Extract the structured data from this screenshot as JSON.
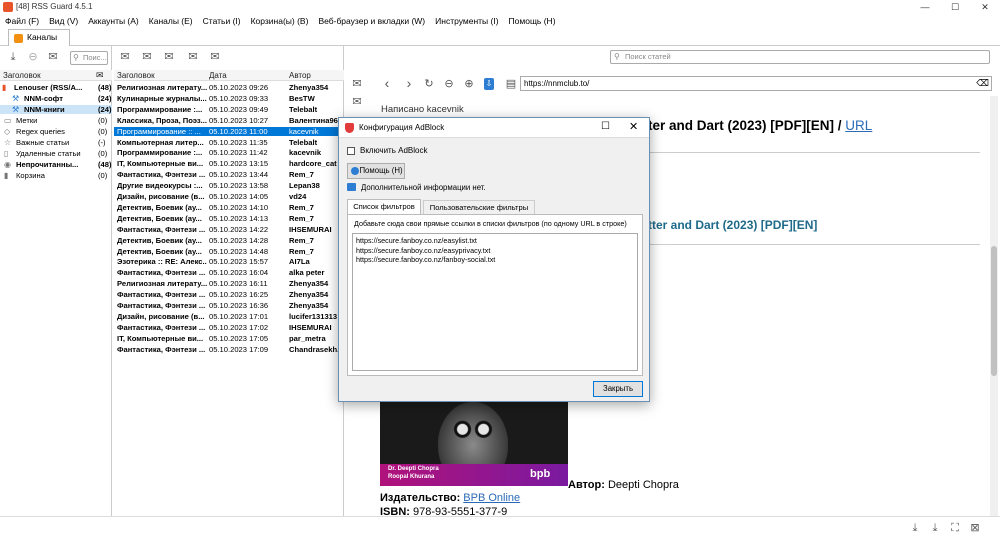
{
  "window": {
    "title": "[48] RSS Guard 4.5.1",
    "minimize": "—",
    "maximize": "☐",
    "close": "✕"
  },
  "menu": [
    "Файл (F)",
    "Вид (V)",
    "Аккаунты (A)",
    "Каналы (E)",
    "Статьи (I)",
    "Корзина(ы) (B)",
    "Веб-браузер и вкладки (W)",
    "Инструменты (I)",
    "Помощь (H)"
  ],
  "tab": {
    "label": "Каналы"
  },
  "feeds_search": {
    "placeholder": "Поис..."
  },
  "articles_search": {
    "placeholder": "Поиск статей"
  },
  "feeds_header": {
    "title": "Заголовок"
  },
  "feeds": [
    {
      "label": "Lenouser (RSS/A...",
      "count": "(48)",
      "bold": true,
      "sel": false
    },
    {
      "label": "NNM-софт",
      "count": "(24)",
      "bold": true,
      "sel": false
    },
    {
      "label": "NNM-книги",
      "count": "(24)",
      "bold": true,
      "sel": true
    },
    {
      "label": "Метки",
      "count": "(0)",
      "bold": false,
      "sel": false
    },
    {
      "label": "Regex queries",
      "count": "(0)",
      "bold": false,
      "sel": false
    },
    {
      "label": "Важные статьи",
      "count": "(-)",
      "bold": false,
      "sel": false
    },
    {
      "label": "Удаленные статьи",
      "count": "(0)",
      "bold": false,
      "sel": false
    },
    {
      "label": "Непрочитанны...",
      "count": "(48)",
      "bold": true,
      "sel": false
    },
    {
      "label": "Корзина",
      "count": "(0)",
      "bold": false,
      "sel": false
    }
  ],
  "articles_header": {
    "title": "Заголовок",
    "date": "Дата",
    "author": "Автор"
  },
  "articles": [
    {
      "title": "Религиозная литерату...",
      "date": "05.10.2023 09:26",
      "author": "Zhenya354"
    },
    {
      "title": "Кулинарные журналы...",
      "date": "05.10.2023 09:33",
      "author": "BesTW"
    },
    {
      "title": "Программирование :...",
      "date": "05.10.2023 09:49",
      "author": "Telebalt"
    },
    {
      "title": "Классика, Проза, Поэз...",
      "date": "05.10.2023 10:27",
      "author": "Валентина96"
    },
    {
      "title": "Программирование :: ...",
      "date": "05.10.2023 11:00",
      "author": "kacevnik"
    },
    {
      "title": "Компьютерная литер...",
      "date": "05.10.2023 11:35",
      "author": "Telebalt"
    },
    {
      "title": "Программирование :...",
      "date": "05.10.2023 11:42",
      "author": "kacevnik"
    },
    {
      "title": "IT, Компьютерные ви...",
      "date": "05.10.2023 13:15",
      "author": "hardcore_cat"
    },
    {
      "title": "Фантастика, Фэнтези ...",
      "date": "05.10.2023 13:44",
      "author": "Rem_7"
    },
    {
      "title": "Другие видеокурсы :...",
      "date": "05.10.2023 13:58",
      "author": "Lepan38"
    },
    {
      "title": "Дизайн, рисование (в...",
      "date": "05.10.2023 14:05",
      "author": "vd24"
    },
    {
      "title": "Детектив, Боевик (ау...",
      "date": "05.10.2023 14:10",
      "author": "Rem_7"
    },
    {
      "title": "Детектив, Боевик (ау...",
      "date": "05.10.2023 14:13",
      "author": "Rem_7"
    },
    {
      "title": "Фантастика, Фэнтези ...",
      "date": "05.10.2023 14:22",
      "author": "IHSEMURAI"
    },
    {
      "title": "Детектив, Боевик (ау...",
      "date": "05.10.2023 14:28",
      "author": "Rem_7"
    },
    {
      "title": "Детектив, Боевик (ау...",
      "date": "05.10.2023 14:48",
      "author": "Rem_7"
    },
    {
      "title": "Эзотерика :: RE: Алекс...",
      "date": "05.10.2023 15:57",
      "author": "AI7La"
    },
    {
      "title": "Фантастика, Фэнтези ...",
      "date": "05.10.2023 16:04",
      "author": "alka peter"
    },
    {
      "title": "Религиозная литерату...",
      "date": "05.10.2023 16:11",
      "author": "Zhenya354"
    },
    {
      "title": "Фантастика, Фэнтези ...",
      "date": "05.10.2023 16:25",
      "author": "Zhenya354"
    },
    {
      "title": "Фантастика, Фэнтези ...",
      "date": "05.10.2023 16:36",
      "author": "Zhenya354"
    },
    {
      "title": "Дизайн, рисование (в...",
      "date": "05.10.2023 17:01",
      "author": "lucifer131313"
    },
    {
      "title": "Фантастика, Фэнтези ...",
      "date": "05.10.2023 17:02",
      "author": "IHSEMURAI"
    },
    {
      "title": "IT, Компьютерные ви...",
      "date": "05.10.2023 17:05",
      "author": "par_metra"
    },
    {
      "title": "Фантастика, Фэнтези ...",
      "date": "05.10.2023 17:09",
      "author": "Chandrasekh..."
    }
  ],
  "selected_article_index": 4,
  "viewer": {
    "url": "https://nnmclub.to/",
    "posted_by": "Написано kacevnik",
    "heading_tail": "ter and Dart (2023) [PDF][EN] / ",
    "heading_link": "URL",
    "subheading_tail": "tter and Dart (2023) [PDF][EN]",
    "cover_author_line1": "Dr. Deepti Chopra",
    "cover_author_line2": "Roopal Khurana",
    "cover_logo": "bpb",
    "author_label": "Автор:",
    "author_value": " Deepti Chopra",
    "publisher_label": "Издательство:",
    "publisher_link": "BPB Online",
    "isbn_label": "ISBN:",
    "isbn_value": " 978-93-5551-377-9"
  },
  "dialog": {
    "title": "Конфигурация AdBlock",
    "enable_label": "Включить AdBlock",
    "help_button": "Помощь (H)",
    "info_text": "Дополнительной информации нет.",
    "tabs": [
      "Список фильтров",
      "Пользовательские фильтры"
    ],
    "instructions": "Добавьте сюда свои прямые ссылки в списки фильтров (по одному URL в строке)",
    "filter_urls": [
      "https://secure.fanboy.co.nz/easylist.txt",
      "https://secure.fanboy.co.nz/easyprivacy.txt",
      "https://secure.fanboy.co.nz/fanboy-social.txt"
    ],
    "close_button": "Закрыть"
  },
  "colors": {
    "accent": "#0078d7",
    "link": "#2a6ab8",
    "heading_link": "#1f6a8a",
    "cover_bg": "#1a1a1a",
    "cover_band": "#b0127a"
  }
}
